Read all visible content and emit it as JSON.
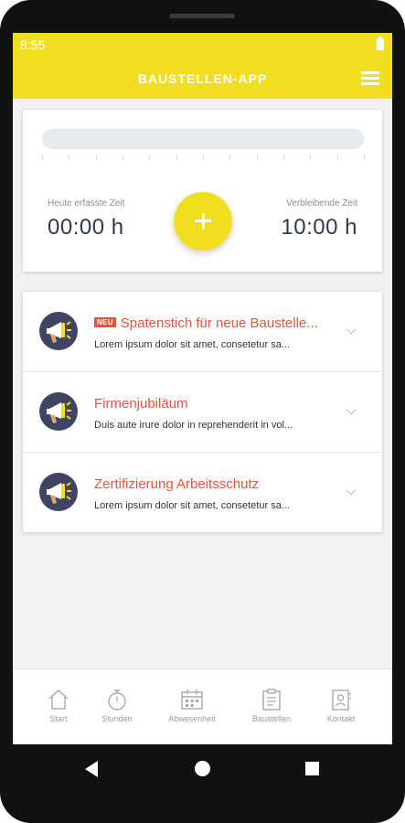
{
  "status_bar": {
    "time": "8:55"
  },
  "app_bar": {
    "title": "BAUSTELLEN-APP",
    "menu_icon": "hamburger-menu-icon"
  },
  "time_tracker": {
    "progress_fraction": 0,
    "left_label": "Heute erfasste Zeit",
    "left_value": "00:00 h",
    "right_label": "Verbleibende Zeit",
    "right_value": "10:00 h",
    "add_icon": "plus-icon"
  },
  "news": [
    {
      "badge": "NEU",
      "title": "Spatenstich für neue Baustelle...",
      "text": "Lorem ipsum dolor sit amet, consetetur sa...",
      "icon": "megaphone-icon"
    },
    {
      "badge": "",
      "title": "Firmenjubiläum",
      "text": "Duis aute irure dolor in reprehenderit in vol...",
      "icon": "megaphone-icon"
    },
    {
      "badge": "",
      "title": "Zertifizierung Arbeitsschutz",
      "text": "Lorem ipsum dolor sit amet, consetetur sa...",
      "icon": "megaphone-icon"
    }
  ],
  "bottom_nav": [
    {
      "label": "Start",
      "icon": "home-icon"
    },
    {
      "label": "Stunden",
      "icon": "stopwatch-icon"
    },
    {
      "label": "Abwesenheit",
      "icon": "calendar-icon"
    },
    {
      "label": "Baustellen",
      "icon": "clipboard-icon"
    },
    {
      "label": "Kontakt",
      "icon": "contact-icon"
    }
  ],
  "colors": {
    "accent": "#f1de20",
    "news_title": "#e8513a",
    "time_text": "#2e3951",
    "avatar_bg": "#3d4563"
  }
}
